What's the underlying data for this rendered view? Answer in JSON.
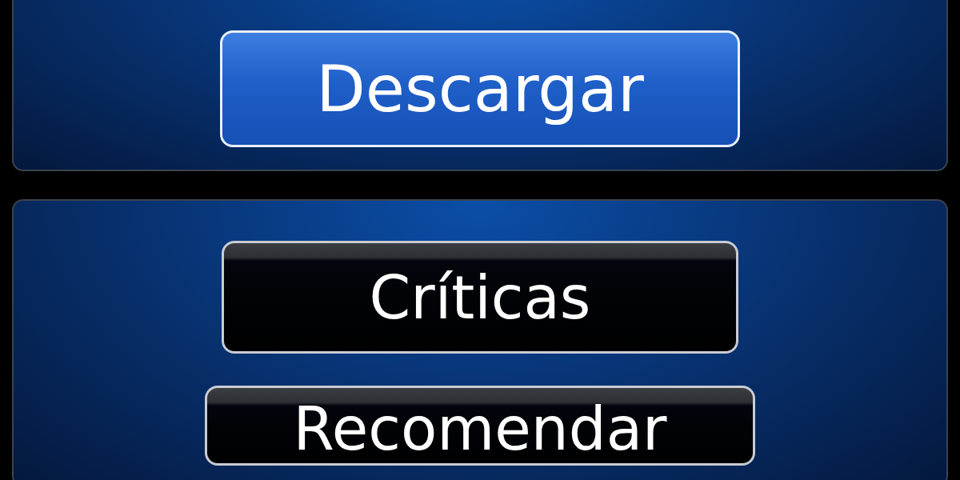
{
  "panels": [
    {
      "buttons": [
        {
          "label": "Descargar",
          "kind": "primary"
        }
      ]
    },
    {
      "buttons": [
        {
          "label": "Críticas",
          "kind": "dark"
        },
        {
          "label": "Recomendar",
          "kind": "dark-wide"
        }
      ]
    }
  ]
}
